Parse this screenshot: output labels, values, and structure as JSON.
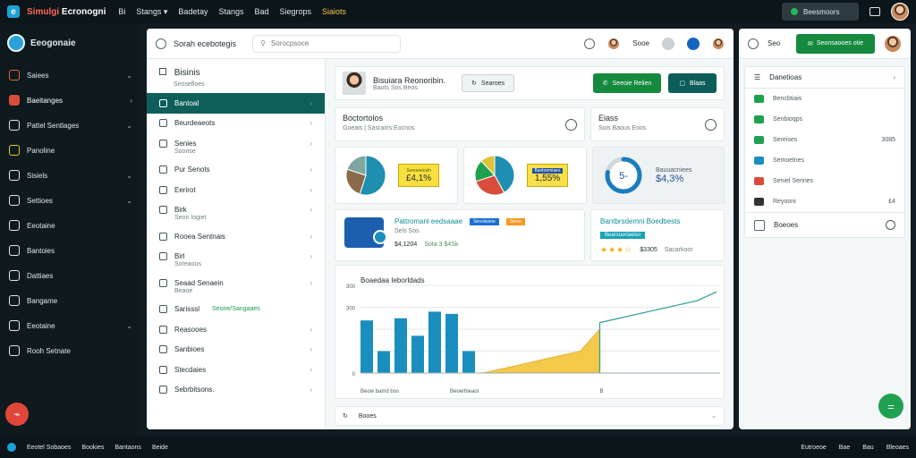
{
  "topbar": {
    "logo_glyph": "e",
    "brand_red": "Simulgi",
    "brand_white": "Ecronogni",
    "menu": [
      "Bi",
      "Stangs ▾",
      "Badetay",
      "Stangs",
      "Bad",
      "Siegrops",
      "Siaiots"
    ],
    "chip_label": "Beesmoors"
  },
  "sidebar": {
    "title": "Eeogonaie",
    "items": [
      {
        "label": "Saiees",
        "chevron": "⌄",
        "color": "#e06a3c"
      },
      {
        "label": "Baeitanges",
        "chevron": "›",
        "color": "#d94c3a",
        "active": true
      },
      {
        "label": "Pattel Sentlages",
        "chevron": "⌄"
      },
      {
        "label": "Panoline",
        "chevron": "",
        "color": "#e8c62a"
      },
      {
        "label": "Sisiels",
        "chevron": "⌄"
      },
      {
        "label": "Settioes",
        "chevron": "⌄"
      },
      {
        "label": "Eeotaine",
        "chevron": ""
      },
      {
        "label": "Bantoies",
        "chevron": ""
      },
      {
        "label": "Dattiaes",
        "chevron": ""
      },
      {
        "label": "Bangame",
        "chevron": ""
      },
      {
        "label": "Eeotaine",
        "chevron": "⌄"
      },
      {
        "label": "Rooh Setnate",
        "chevron": ""
      }
    ],
    "fab_glyph": "⌁"
  },
  "main": {
    "header": {
      "title": "Sorah ecebotegis",
      "search_placeholder": "Sorocpsoce",
      "user_label": "Sooe"
    },
    "subnav": {
      "title": "Bisinis",
      "subtitle": "Seosefloes",
      "items": [
        {
          "label": "Bantoal",
          "active": true
        },
        {
          "label": "Beurdeaeots",
          "sub": ""
        },
        {
          "label": "Senies",
          "sub": "Soonse"
        },
        {
          "label": "Pur Senots",
          "sub": ""
        },
        {
          "label": "Eerirot",
          "sub": ""
        },
        {
          "label": "Birk",
          "sub": "Seon Iogiet"
        },
        {
          "label": "Rooea Sentnais",
          "sub": ""
        },
        {
          "label": "Birl",
          "sub": "Soreaous"
        },
        {
          "label": "Seaad Senaein",
          "sub": "Beaoe"
        },
        {
          "label": "Sarisssl",
          "sub": "",
          "tag": "Seone/Sangaaes"
        },
        {
          "label": "Reasooes",
          "sub": ""
        },
        {
          "label": "Sanbioes",
          "sub": ""
        },
        {
          "label": "Stecdaies",
          "sub": ""
        },
        {
          "label": "Sebrbitsons.",
          "sub": ""
        }
      ]
    },
    "profile": {
      "name": "Bisuiara Reonoribin.",
      "sub": "Baots Sos Beos",
      "outline_btn": "Searoes",
      "green_btn": "Seeoie Relien",
      "teal_btn": "Blaas"
    },
    "sections": [
      {
        "title": "Boctortolos",
        "sub": "Goeais | Sasrairis Eocnos"
      },
      {
        "title": "Eiass",
        "sub": "Sois Baous Eoos"
      }
    ],
    "stats": [
      {
        "box_caption": "Seeoeeicaln",
        "value": "£4,1%",
        "pie": [
          0.55,
          0.25,
          0.2
        ],
        "pie_colors": [
          "#1e8fb0",
          "#8a6a4a",
          "#7fa6a0"
        ]
      },
      {
        "box_caption": "Bavtoemiaes",
        "value": "1,55%",
        "pie": [
          0.42,
          0.28,
          0.18,
          0.12
        ],
        "pie_colors": [
          "#1e8fb0",
          "#d94c3a",
          "#1fa24f",
          "#e0c23a"
        ]
      },
      {
        "label": "Bauuacniees",
        "value": "$4,3%",
        "progress": 0.78,
        "glyph": "5-"
      }
    ],
    "promos": [
      {
        "title": "Pattromanl eedsaaae",
        "sub": "Sels Sos",
        "amount": "$4,1204",
        "meta": "Sota 3 $4Sk",
        "tag1": "Senoisoine",
        "tag2": "Seros"
      },
      {
        "title": "Bantbrsdemni Boedbests",
        "tag": "Bearsooriaeiso",
        "stars": "★★★☆",
        "amount": "$3305",
        "meta": "Sacarkoor"
      }
    ],
    "chart_title": "Boaedaa Ieborldads",
    "accordion_label": "Booes"
  },
  "chart_data": {
    "type": "bar",
    "title": "Boaedaa Ieborldads",
    "xlabel": "",
    "ylabel": "",
    "ylim": [
      0,
      400
    ],
    "yticks": [
      0,
      100,
      200,
      300,
      400
    ],
    "ytick_labels": [
      "0",
      "",
      "",
      "300",
      "300"
    ],
    "x_labels": [
      "Beow bamd bos",
      "Beoerbieaol",
      "B"
    ],
    "bars": [
      240,
      100,
      250,
      170,
      280,
      270,
      100
    ],
    "area": [
      0,
      20,
      40,
      60,
      80,
      100,
      200
    ],
    "line": [
      230,
      250,
      270,
      290,
      310,
      330,
      370
    ],
    "bar_color": "#1a8fbf",
    "area_color": "#f3c94a",
    "line_color": "#2f9c99",
    "grid": true
  },
  "right": {
    "header_label": "Seo",
    "button_label": "Seonsaooes otie",
    "list_title": "Danetioas",
    "rows": [
      {
        "label": "Bencbtiais",
        "value": "",
        "color": "#1fa24f"
      },
      {
        "label": "Senbioqps",
        "value": "",
        "color": "#1fa24f"
      },
      {
        "label": "Sereises",
        "value": "3085",
        "color": "#1fa24f"
      },
      {
        "label": "Semoelnes",
        "value": "",
        "color": "#1a8fbf"
      },
      {
        "label": "Seniel Serines",
        "value": "",
        "color": "#d94c3a"
      },
      {
        "label": "Reyooni",
        "value": "£4",
        "color": "#333333"
      }
    ],
    "footer_label": "Boeoes"
  },
  "statusbar": {
    "left": [
      "Eeotel Sobaoes",
      "Bookies",
      "Bantaons",
      "Beide"
    ],
    "right": [
      "Eutroeoe",
      "Bae",
      "Bau",
      "Bleoaes"
    ]
  }
}
